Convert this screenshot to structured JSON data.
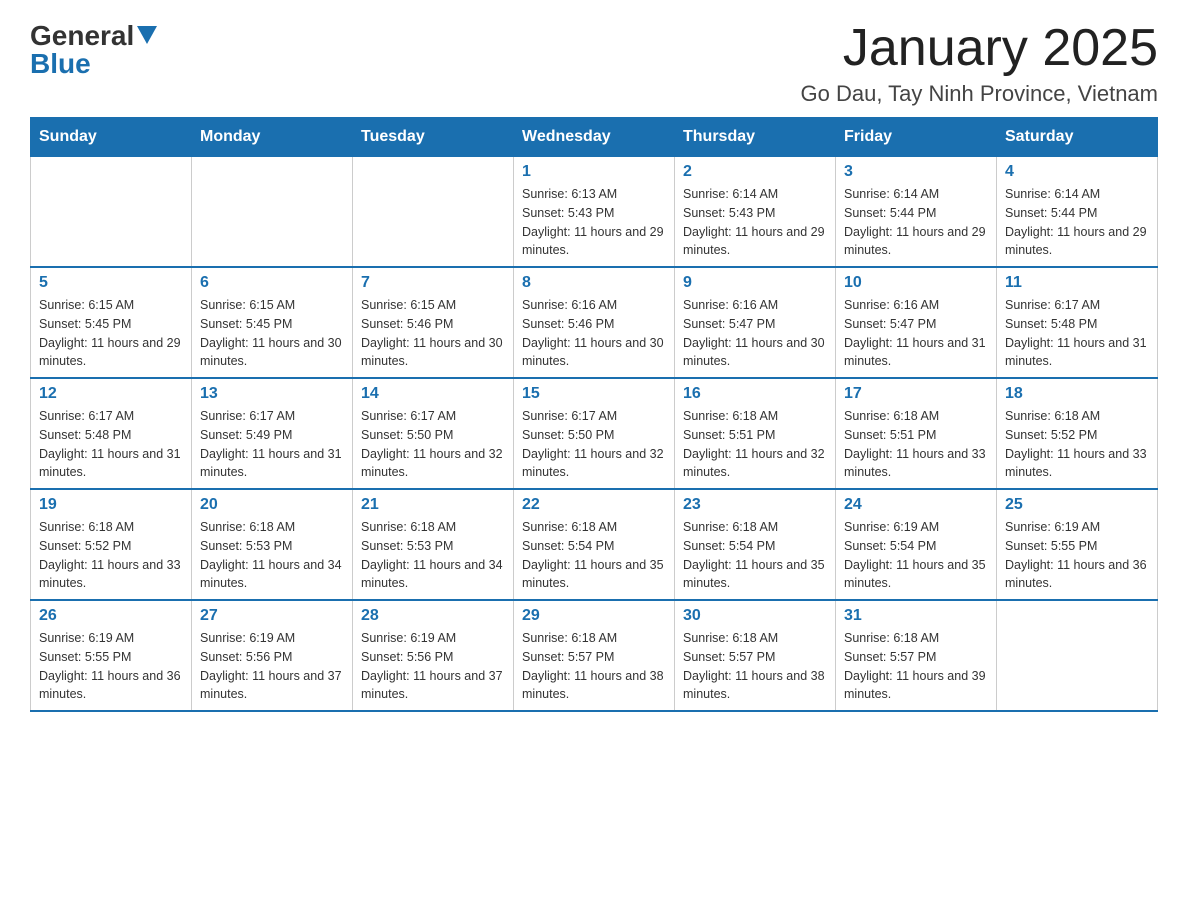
{
  "logo": {
    "text_general": "General",
    "text_blue": "Blue"
  },
  "title": "January 2025",
  "subtitle": "Go Dau, Tay Ninh Province, Vietnam",
  "calendar": {
    "headers": [
      "Sunday",
      "Monday",
      "Tuesday",
      "Wednesday",
      "Thursday",
      "Friday",
      "Saturday"
    ],
    "weeks": [
      [
        {
          "day": "",
          "info": ""
        },
        {
          "day": "",
          "info": ""
        },
        {
          "day": "",
          "info": ""
        },
        {
          "day": "1",
          "info": "Sunrise: 6:13 AM\nSunset: 5:43 PM\nDaylight: 11 hours and 29 minutes."
        },
        {
          "day": "2",
          "info": "Sunrise: 6:14 AM\nSunset: 5:43 PM\nDaylight: 11 hours and 29 minutes."
        },
        {
          "day": "3",
          "info": "Sunrise: 6:14 AM\nSunset: 5:44 PM\nDaylight: 11 hours and 29 minutes."
        },
        {
          "day": "4",
          "info": "Sunrise: 6:14 AM\nSunset: 5:44 PM\nDaylight: 11 hours and 29 minutes."
        }
      ],
      [
        {
          "day": "5",
          "info": "Sunrise: 6:15 AM\nSunset: 5:45 PM\nDaylight: 11 hours and 29 minutes."
        },
        {
          "day": "6",
          "info": "Sunrise: 6:15 AM\nSunset: 5:45 PM\nDaylight: 11 hours and 30 minutes."
        },
        {
          "day": "7",
          "info": "Sunrise: 6:15 AM\nSunset: 5:46 PM\nDaylight: 11 hours and 30 minutes."
        },
        {
          "day": "8",
          "info": "Sunrise: 6:16 AM\nSunset: 5:46 PM\nDaylight: 11 hours and 30 minutes."
        },
        {
          "day": "9",
          "info": "Sunrise: 6:16 AM\nSunset: 5:47 PM\nDaylight: 11 hours and 30 minutes."
        },
        {
          "day": "10",
          "info": "Sunrise: 6:16 AM\nSunset: 5:47 PM\nDaylight: 11 hours and 31 minutes."
        },
        {
          "day": "11",
          "info": "Sunrise: 6:17 AM\nSunset: 5:48 PM\nDaylight: 11 hours and 31 minutes."
        }
      ],
      [
        {
          "day": "12",
          "info": "Sunrise: 6:17 AM\nSunset: 5:48 PM\nDaylight: 11 hours and 31 minutes."
        },
        {
          "day": "13",
          "info": "Sunrise: 6:17 AM\nSunset: 5:49 PM\nDaylight: 11 hours and 31 minutes."
        },
        {
          "day": "14",
          "info": "Sunrise: 6:17 AM\nSunset: 5:50 PM\nDaylight: 11 hours and 32 minutes."
        },
        {
          "day": "15",
          "info": "Sunrise: 6:17 AM\nSunset: 5:50 PM\nDaylight: 11 hours and 32 minutes."
        },
        {
          "day": "16",
          "info": "Sunrise: 6:18 AM\nSunset: 5:51 PM\nDaylight: 11 hours and 32 minutes."
        },
        {
          "day": "17",
          "info": "Sunrise: 6:18 AM\nSunset: 5:51 PM\nDaylight: 11 hours and 33 minutes."
        },
        {
          "day": "18",
          "info": "Sunrise: 6:18 AM\nSunset: 5:52 PM\nDaylight: 11 hours and 33 minutes."
        }
      ],
      [
        {
          "day": "19",
          "info": "Sunrise: 6:18 AM\nSunset: 5:52 PM\nDaylight: 11 hours and 33 minutes."
        },
        {
          "day": "20",
          "info": "Sunrise: 6:18 AM\nSunset: 5:53 PM\nDaylight: 11 hours and 34 minutes."
        },
        {
          "day": "21",
          "info": "Sunrise: 6:18 AM\nSunset: 5:53 PM\nDaylight: 11 hours and 34 minutes."
        },
        {
          "day": "22",
          "info": "Sunrise: 6:18 AM\nSunset: 5:54 PM\nDaylight: 11 hours and 35 minutes."
        },
        {
          "day": "23",
          "info": "Sunrise: 6:18 AM\nSunset: 5:54 PM\nDaylight: 11 hours and 35 minutes."
        },
        {
          "day": "24",
          "info": "Sunrise: 6:19 AM\nSunset: 5:54 PM\nDaylight: 11 hours and 35 minutes."
        },
        {
          "day": "25",
          "info": "Sunrise: 6:19 AM\nSunset: 5:55 PM\nDaylight: 11 hours and 36 minutes."
        }
      ],
      [
        {
          "day": "26",
          "info": "Sunrise: 6:19 AM\nSunset: 5:55 PM\nDaylight: 11 hours and 36 minutes."
        },
        {
          "day": "27",
          "info": "Sunrise: 6:19 AM\nSunset: 5:56 PM\nDaylight: 11 hours and 37 minutes."
        },
        {
          "day": "28",
          "info": "Sunrise: 6:19 AM\nSunset: 5:56 PM\nDaylight: 11 hours and 37 minutes."
        },
        {
          "day": "29",
          "info": "Sunrise: 6:18 AM\nSunset: 5:57 PM\nDaylight: 11 hours and 38 minutes."
        },
        {
          "day": "30",
          "info": "Sunrise: 6:18 AM\nSunset: 5:57 PM\nDaylight: 11 hours and 38 minutes."
        },
        {
          "day": "31",
          "info": "Sunrise: 6:18 AM\nSunset: 5:57 PM\nDaylight: 11 hours and 39 minutes."
        },
        {
          "day": "",
          "info": ""
        }
      ]
    ]
  }
}
